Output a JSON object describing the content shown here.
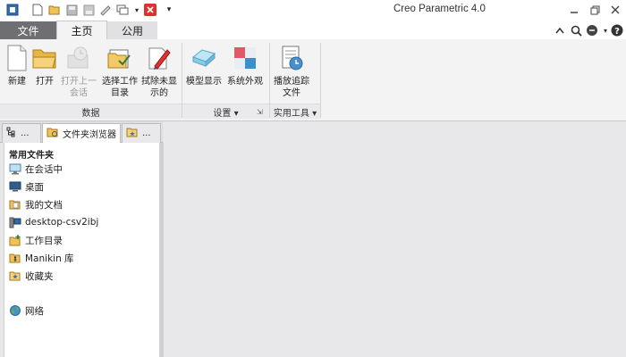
{
  "app_title": "Creo Parametric 4.0",
  "tabs": [
    {
      "label": "文件"
    },
    {
      "label": "主页"
    },
    {
      "label": "公用"
    }
  ],
  "ribbon": {
    "buttons": [
      {
        "label": "新建",
        "enabled": true,
        "icon": "new-file-icon"
      },
      {
        "label": "打开",
        "enabled": true,
        "icon": "open-folder-icon"
      },
      {
        "label": "打开上一会话",
        "enabled": false,
        "icon": "open-last-session-icon"
      },
      {
        "label": "选择工作目录",
        "enabled": true,
        "icon": "select-working-dir-icon"
      },
      {
        "label": "拭除未显示的",
        "enabled": true,
        "icon": "erase-not-displayed-icon"
      },
      {
        "label": "模型显示",
        "enabled": true,
        "icon": "model-display-icon"
      },
      {
        "label": "系统外观",
        "enabled": true,
        "icon": "system-appearance-icon"
      },
      {
        "label": "播放追踪文件",
        "enabled": true,
        "icon": "play-trail-file-icon"
      }
    ],
    "groups": [
      {
        "label": "数据"
      },
      {
        "label": "设置 ▾"
      },
      {
        "label": "实用工具 ▾"
      }
    ]
  },
  "navigator": {
    "tabs": [
      {
        "label": "..."
      },
      {
        "label": "文件夹浏览器"
      },
      {
        "label": "..."
      }
    ],
    "section_title": "常用文件夹",
    "folders": [
      {
        "label": "在会话中",
        "icon": "in-session-icon"
      },
      {
        "label": "桌面",
        "icon": "desktop-icon"
      },
      {
        "label": "我的文档",
        "icon": "my-documents-icon"
      },
      {
        "label": "desktop-csv2ibj",
        "icon": "computer-icon"
      },
      {
        "label": "工作目录",
        "icon": "working-directory-icon"
      },
      {
        "label": "Manikin 库",
        "icon": "manikin-library-icon"
      },
      {
        "label": "收藏夹",
        "icon": "favorites-icon"
      },
      {
        "label": "网络",
        "icon": "network-icon"
      }
    ]
  },
  "colors": {
    "file_tab_bg": "#6e6e73",
    "ribbon_bg": "#f3f3f4",
    "graphics_bg": "#e8e8eb",
    "close_red": "#d9342b"
  }
}
